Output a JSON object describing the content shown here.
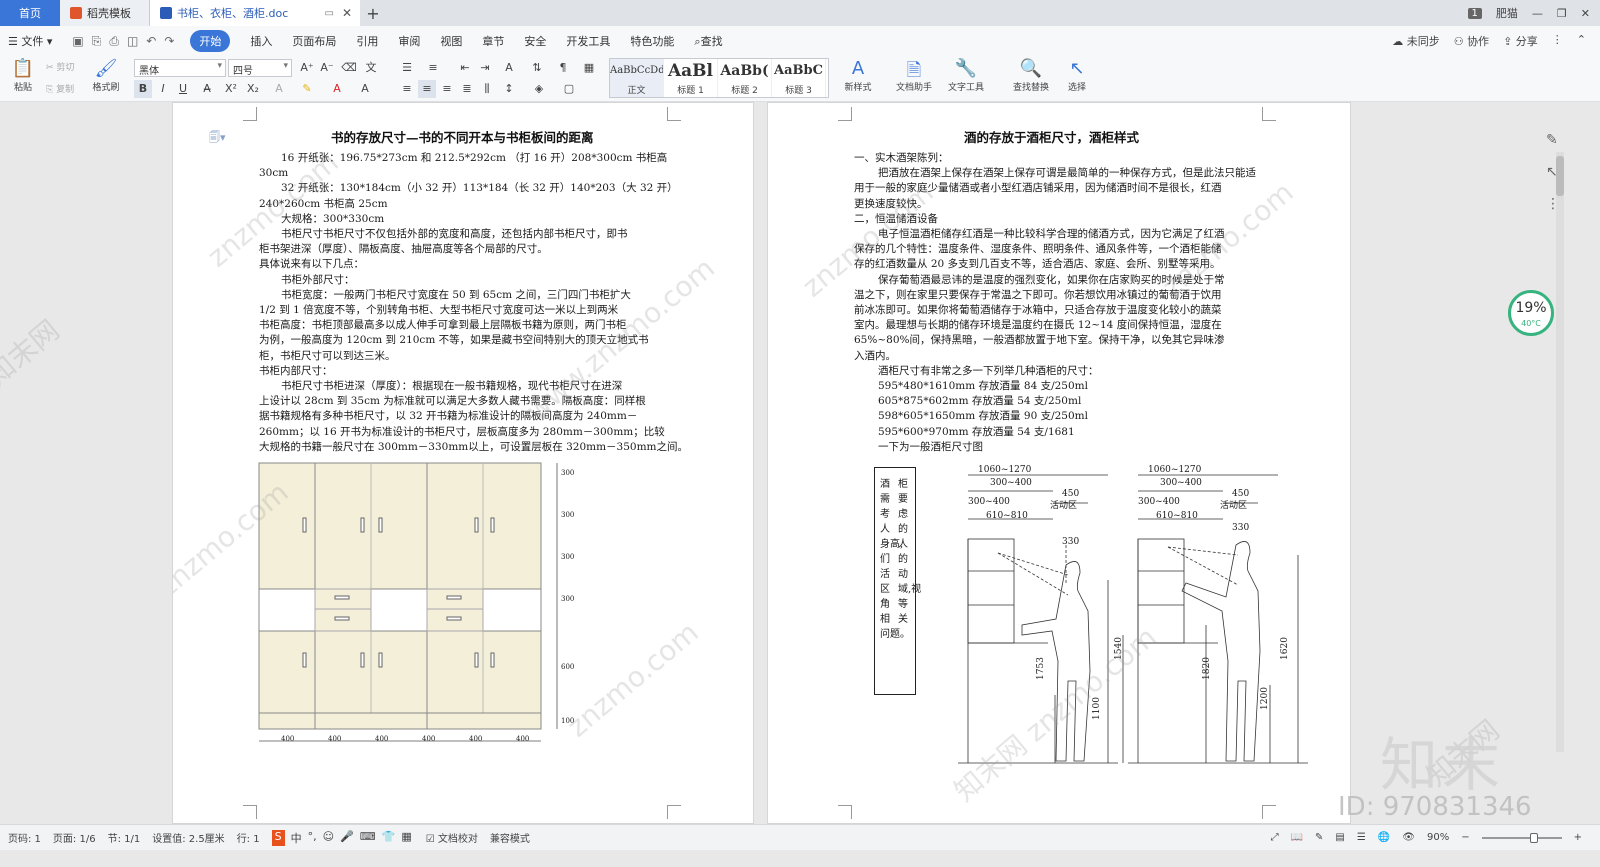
{
  "tabs": {
    "home": "首页",
    "template": "稻壳模板",
    "doc": "书柜、衣柜、酒柜.doc",
    "new_tab": "+"
  },
  "title_right": {
    "badge": "1",
    "user": "肥猫"
  },
  "menu": {
    "file": "文件",
    "items": [
      "开始",
      "插入",
      "页面布局",
      "引用",
      "审阅",
      "视图",
      "章节",
      "安全",
      "开发工具",
      "特色功能"
    ],
    "search": "查找",
    "sync": "未同步",
    "collab": "协作",
    "share": "分享"
  },
  "ribbon": {
    "paste": "粘贴",
    "cut": "剪切",
    "copy": "复制",
    "format_painter": "格式刷",
    "font_name": "黑体",
    "font_size": "四号",
    "styles": [
      {
        "sample": "AaBbCcDd",
        "label": "正文"
      },
      {
        "sample": "AaBl",
        "label": "标题 1"
      },
      {
        "sample": "AaBb(",
        "label": "标题 2"
      },
      {
        "sample": "AaBbC",
        "label": "标题 3"
      }
    ],
    "new_style": "新样式",
    "doc_helper": "文档助手",
    "text_tools": "文字工具",
    "find_replace": "查找替换",
    "select": "选择"
  },
  "left_page": {
    "title": "书的存放尺寸—书的不同开本与书柜板间的距离",
    "paragraphs": [
      "16 开纸张：196.75*273cm 和 212.5*292cm （打 16 开）208*300cm 书柜高",
      "30cm",
      "32 开纸张：130*184cm（小 32 开）113*184（长 32 开）140*203（大 32 开）",
      "240*260cm 书柜高 25cm",
      "大规格：300*330cm",
      "书柜尺寸书柜尺寸不仅包括外部的宽度和高度，还包括内部书柜尺寸，即书",
      "柜书架进深（厚度）、隔板高度、抽屉高度等各个局部的尺寸。",
      "具体说来有以下几点：",
      "书柜外部尺寸：",
      "书柜宽度：一般两门书柜尺寸宽度在 50 到 65cm 之间，三门四门书柜扩大",
      "1/2 到 1 倍宽度不等，个别转角书柜、大型书柜尺寸宽度可达一米以上到两米",
      "书柜高度：书柜顶部最高多以成人伸手可拿到最上层隔板书籍为原则，两门书柜",
      "为例，一般高度为 120cm 到 210cm 不等，如果是藏书空间特别大的顶天立地式书",
      "柜，书柜尺寸可以到达三米。",
      "书柜内部尺寸：",
      "书柜尺寸书柜进深（厚度）：根据现在一般书籍规格，现代书柜尺寸在进深",
      "上设计以 28cm 到 35cm 为标准就可以满足大多数人藏书需要。隔板高度：同样根",
      "据书籍规格有多种书柜尺寸，以 32 开书籍为标准设计的隔板间高度为 240mm－",
      "260mm；以 16 开书为标准设计的书柜尺寸，层板高度多为 280mm－300mm；比较",
      "大规格的书籍一般尺寸在 300mm－330mm以上，可设置层板在 320mm－350mm之间。"
    ],
    "dims_right": [
      "300",
      "300",
      "300",
      "300",
      "600",
      "100"
    ],
    "dims_bottom": [
      "400",
      "400",
      "400",
      "400",
      "400",
      "400"
    ]
  },
  "right_page": {
    "title": "酒的存放于酒柜尺寸，酒柜样式",
    "paragraphs": [
      "一、实木酒架陈列：",
      "把酒放在酒架上保存在酒架上保存可谓是最简单的一种保存方式，但是此法只能适",
      "用于一般的家庭少量储酒或者小型红酒店铺采用，因为储酒时间不是很长，红酒",
      "更换速度较快。",
      "二，恒温储酒设备",
      "电子恒温酒柜储存红酒是一种比较科学合理的储酒方式，因为它满足了红酒",
      "保存的几个特性：温度条件、湿度条件、照明条件、通风条件等，一个酒柜能储",
      "存的红酒数量从 20 多支到几百支不等，适合酒店、家庭、会所、别墅等采用。",
      "保存葡萄酒最忌讳的是温度的强烈变化，如果你在店家购买的时候是处于常",
      "温之下，则在家里只要保存于常温之下即可。你若想饮用冰镇过的葡萄酒于饮用",
      "前冰冻即可。如果你将葡萄酒储存于冰箱中，只适合存放于温度变化较小的蔬菜",
      "室内。最理想与长期的储存环境是温度约在摄氏 12~14 度间保持恒温，湿度在",
      "65%~80%间，保持黑暗，一般酒都放置于地下室。保持干净，以免其它异味渗",
      "入酒内。",
      "酒柜尺寸有非常之多一下列举几种酒柜的尺寸：",
      "595*480*1610mm 存放酒量 84 支/250ml",
      "605*875*602mm 存放酒量 54 支/250ml",
      "598*605*1650mm 存放酒量 90 支/250ml",
      "595*600*970mm 存放酒量 54 支/1681",
      "一下为一般酒柜尺寸图"
    ],
    "note": [
      "酒",
      "柜",
      "需",
      "要",
      "考",
      "虑",
      "人",
      "的",
      "身高,",
      "人",
      "们",
      "的",
      "活",
      "动",
      "区",
      "域,视",
      "角",
      "等",
      "相",
      "关",
      "问题。"
    ],
    "dims": {
      "top": "1060~1270",
      "mid": "300~400",
      "gap": "450",
      "active": "活动区",
      "a": "300~400",
      "b": "610~810",
      "c": "330",
      "h1": "1753",
      "h2": "1540",
      "h3": "1100",
      "h4": "1820",
      "h5": "1620",
      "h6": "1200"
    }
  },
  "gauge": {
    "value": "19%",
    "temp": "40°C"
  },
  "status": {
    "page": "页码: 1",
    "pages": "页面: 1/6",
    "section": "节: 1/1",
    "setting": "设置值: 2.5厘米",
    "row": "行: 1",
    "proof": "文档校对",
    "compat": "兼容模式",
    "zoom": "90%"
  },
  "watermark": {
    "brand": "知末",
    "id": "ID: 970831346"
  }
}
